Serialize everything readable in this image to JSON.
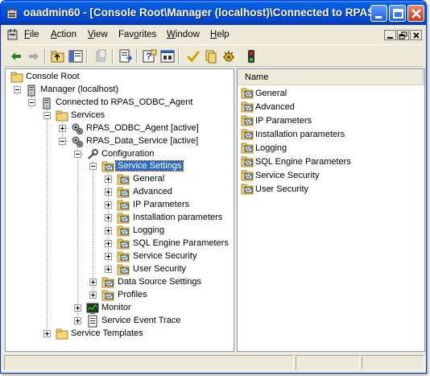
{
  "window": {
    "title": "oaadmin60 - [Console Root\\Manager (localhost)\\Connected to RPAS..."
  },
  "menu": {
    "items": [
      "File",
      "Action",
      "View",
      "Favorites",
      "Window",
      "Help"
    ],
    "mnemonics": [
      "F",
      "A",
      "V",
      "o",
      "W",
      "H"
    ]
  },
  "toolbar": {
    "icons": [
      "back-arrow-icon",
      "forward-arrow-icon",
      "up-folder-icon",
      "show-hide-tree-icon",
      "delete-icon",
      "export-list-icon",
      "help-icon",
      "properties-icon",
      "check-icon",
      "copy-icon",
      "gear-bug-icon",
      "traffic-light-icon"
    ]
  },
  "tree": {
    "console_root": "Console Root",
    "manager": "Manager (localhost)",
    "connected": "Connected to RPAS_ODBC_Agent",
    "services": "Services",
    "odbc_agent": "RPAS_ODBC_Agent [active]",
    "data_service": "RPAS_Data_Service [active]",
    "configuration": "Configuration",
    "service_settings": "Service Settings",
    "settings_children": [
      "General",
      "Advanced",
      "IP Parameters",
      "Installation parameters",
      "Logging",
      "SQL Engine Parameters",
      "Service Security",
      "User Security"
    ],
    "data_source_settings": "Data Source Settings",
    "profiles": "Profiles",
    "monitor": "Monitor",
    "service_event_trace": "Service Event Trace",
    "service_templates": "Service Templates"
  },
  "list": {
    "column_header": "Name",
    "items": [
      "General",
      "Advanced",
      "IP Parameters",
      "Installation parameters",
      "Logging",
      "SQL Engine Parameters",
      "Service Security",
      "User Security"
    ]
  },
  "colors": {
    "titlebar": "#0054e3",
    "selection": "#316ac5",
    "window_bg": "#ece9d8"
  }
}
